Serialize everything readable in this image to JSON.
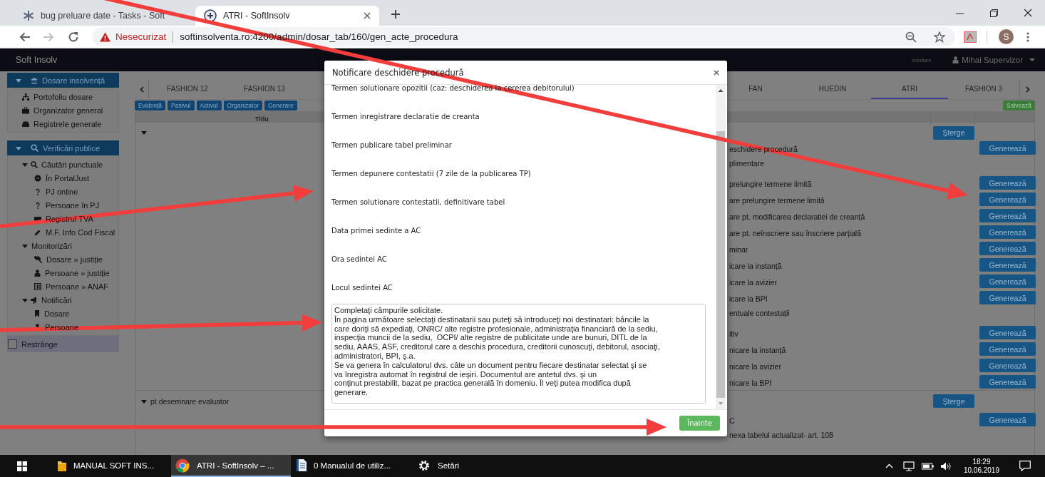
{
  "browser": {
    "tabs": [
      {
        "title": "bug preluare date - Tasks - Soft",
        "selected": false
      },
      {
        "title": "ATRI - SoftInsolv",
        "selected": true
      }
    ],
    "security_label": "Nesecurizat",
    "url": "softinsolventa.ro:4200/admin/dosar_tab/160/gen_acte_procedura",
    "profile_initial": "S"
  },
  "app": {
    "brand": "Soft Insolv",
    "hint": "orientare",
    "user": "Mihai Supervizor"
  },
  "sidebar": {
    "sections": [
      {
        "title": "Dosare insolvență",
        "expanded": true,
        "items": [
          {
            "label": "Portofoliu dosare"
          },
          {
            "label": "Organizator general"
          },
          {
            "label": "Registrele generale"
          }
        ]
      },
      {
        "title": "Verificări publice",
        "expanded": true,
        "items": [
          {
            "label": "Căutări punctuale",
            "expanded": true,
            "children": [
              {
                "label": "În PortalJust"
              },
              {
                "label": "PJ online"
              },
              {
                "label": "Persoane în PJ"
              },
              {
                "label": "Registrul TVA"
              },
              {
                "label": "M.F. Info Cod Fiscal"
              }
            ]
          },
          {
            "label": "Monitorizări",
            "expanded": true,
            "children": [
              {
                "label": "Dosare » justiție"
              },
              {
                "label": "Persoane » justiție"
              },
              {
                "label": "Persoane » ANAF"
              }
            ]
          },
          {
            "label": "Notificări",
            "expanded": true,
            "children": [
              {
                "label": "Dosare"
              },
              {
                "label": "Persoane"
              }
            ]
          }
        ]
      }
    ],
    "collapse": {
      "label": "Restrânge",
      "checked": false
    }
  },
  "tabs_left": [
    {
      "label": "FASHION 12",
      "selected": false
    },
    {
      "label": "FASHION 13",
      "selected": false
    }
  ],
  "tabs_right": [
    {
      "label": "FAN",
      "selected": false
    },
    {
      "label": "HUEDIN",
      "selected": false
    },
    {
      "label": "ATRI",
      "selected": true
    },
    {
      "label": "FASHION 3",
      "selected": false
    }
  ],
  "toolbar_buttons": [
    "Evidență",
    "Pasivul",
    "Activul",
    "Organizator",
    "Generare"
  ],
  "save_button": "Salvează",
  "table": {
    "columns": [
      "Titlu"
    ],
    "groups": [
      {
        "expanded": true,
        "delete_label": "Șterge",
        "rows": [
          {
            "text": "eschidere procedură",
            "button": "Generează"
          },
          {
            "text": "plimentare"
          },
          {
            "text": "prelungire termene limită",
            "button": "Generează"
          },
          {
            "text": "are prelungire termene limită",
            "button": "Generează"
          },
          {
            "text": "are pt. modificarea declaratiei de creanță",
            "button": "Generează"
          },
          {
            "text": "are pt. neînscriere sau înscriere parțială",
            "button": "Generează"
          },
          {
            "text": "minar",
            "button": "Generează"
          },
          {
            "text": "icare la instanță",
            "button": "Generează"
          },
          {
            "text": "icare la avizier",
            "button": "Generează"
          },
          {
            "text": "icare la BPI",
            "button": "Generează"
          },
          {
            "text": "entuale contestații"
          },
          {
            "text": "itiv",
            "button": "Generează"
          },
          {
            "text": "nicare la instanță",
            "button": "Generează"
          },
          {
            "text": "nicare la avizier",
            "button": "Generează"
          },
          {
            "text": "nicare la BPI",
            "button": "Generează"
          }
        ]
      },
      {
        "title": "pt desemnare evaluator",
        "expanded": true,
        "delete_label": "Șterge",
        "rows": [
          {
            "text": "C",
            "button": "Generează"
          },
          {
            "text": "nexa tabelul actualizat- art. 108"
          }
        ]
      }
    ]
  },
  "modal": {
    "title": "Notificare deschidere procedură",
    "fields": [
      "Termen solutionare opozitii (caz: deschiderea la cererea debitorului)",
      "Termen inregistrare declaratie de creanta",
      "Termen publicare tabel preliminar",
      "Termen depunere contestatii (7 zile de la publicarea TP)",
      "Termen solutionare contestatii, definitivare tabel",
      "Data primei sedinte a AC",
      "Ora sedintei AC",
      "Locul sedintei AC"
    ],
    "info_text": "Completaţi câmpurile solicitate.\nÎn pagina următoare selectaţi destinatarii sau puteţi să introduceţi noi destinatari: băncile la\ncare doriţi să expediaţi, ONRC/ alte registre profesionale, administraţia financiară de la sediu,\ninspecţia muncii de la sediu,  OCPI/ alte registre de publicitate unde are bunuri, DITL de la\nsediu, AAAS, ASF, creditorul care a deschis procedura, creditorii cunoscuţi, debitorul, asociaţi,\nadministratori, BPI, ş.a.\nSe va genera în calculatorul dvs. câte un document pentru fiecare destinatar selectat şi se\nva înregistra automat în registrul de ieşiri. Documentul are antetul dvs. şi un\nconţinut prestabilit, bazat pe practica generală în domeniu. Îl veţi putea modifica după\ngenerare.",
    "next_button": "Înainte"
  },
  "taskbar": {
    "items": [
      {
        "label": "MANUAL SOFT INS...",
        "kind": "folder",
        "selected": false
      },
      {
        "label": "ATRI - SoftInsolv – ...",
        "kind": "browser",
        "selected": true
      },
      {
        "label": "0 Manualul de utiliz...",
        "kind": "document",
        "selected": false
      },
      {
        "label": "Setări",
        "kind": "settings",
        "selected": false
      }
    ],
    "time": "18:29",
    "date": "10.06.2019"
  }
}
